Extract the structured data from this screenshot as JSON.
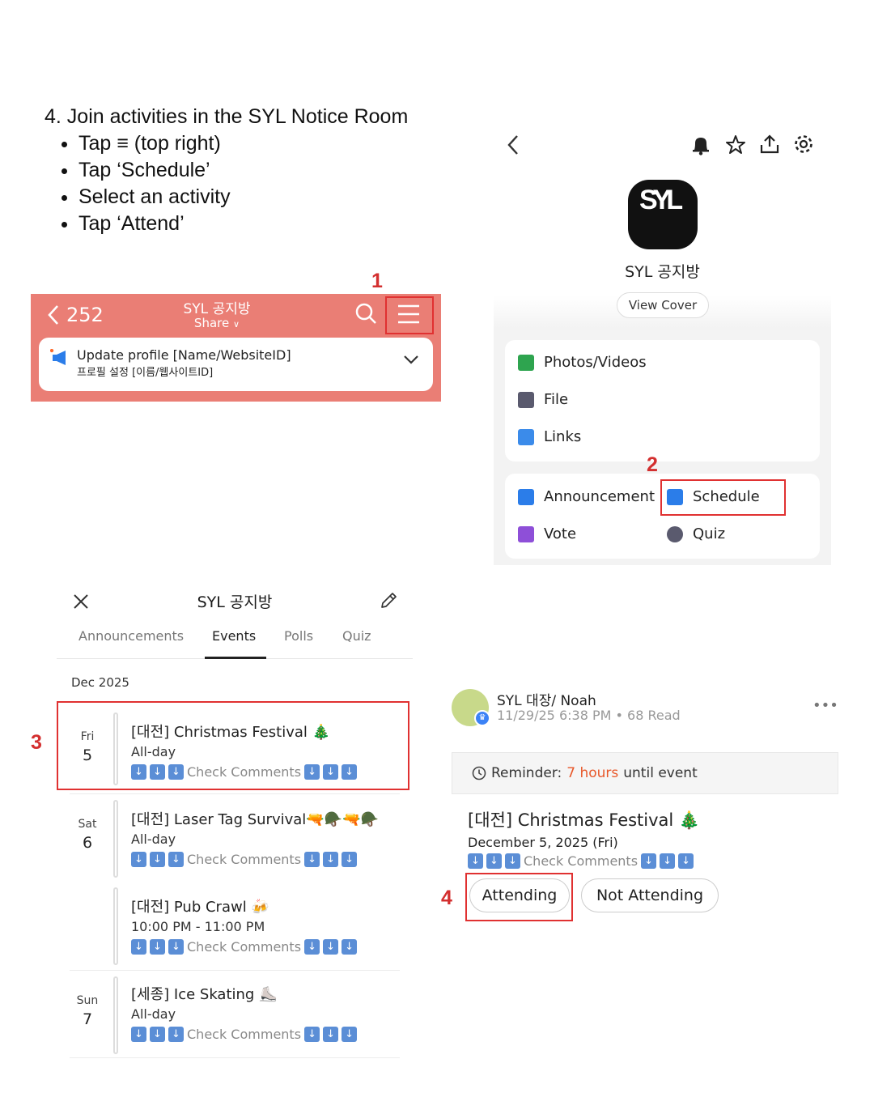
{
  "instructions": {
    "heading": "4. Join activities in the SYL Notice Room",
    "steps": [
      "Tap ≡ (top right)",
      "Tap ‘Schedule’",
      "Select an activity",
      "Tap ‘Attend’"
    ]
  },
  "step_numbers": [
    "1",
    "2",
    "3",
    "4"
  ],
  "chat_header": {
    "count": "252",
    "title": "SYL 공지방",
    "share": "Share",
    "notice_line1": "Update profile [Name/WebsiteID]",
    "notice_line2": "프로필 설정 [이름/웹사이트ID]"
  },
  "room_menu": {
    "logo_text": "SYL",
    "room_name": "SYL 공지방",
    "view_cover": "View Cover",
    "media": [
      "Photos/Videos",
      "File",
      "Links"
    ],
    "tools": [
      "Announcement",
      "Schedule",
      "Vote",
      "Quiz"
    ]
  },
  "events_screen": {
    "title": "SYL 공지방",
    "tabs": [
      "Announcements",
      "Events",
      "Polls",
      "Quiz"
    ],
    "active_tab": "Events",
    "month": "Dec 2025",
    "check_comments": "Check Comments",
    "events": [
      {
        "dow": "Fri",
        "day": "5",
        "title": "[대전] Christmas Festival 🎄",
        "time": "All-day"
      },
      {
        "dow": "Sat",
        "day": "6",
        "title": "[대전] Laser Tag Survival🔫🪖🔫🪖",
        "time": "All-day"
      },
      {
        "dow": "",
        "day": "",
        "title": "[대전] Pub Crawl 🍻",
        "time": "10:00 PM - 11:00 PM"
      },
      {
        "dow": "Sun",
        "day": "7",
        "title": "[세종] Ice Skating ⛸️",
        "time": "All-day"
      }
    ]
  },
  "event_post": {
    "author": "SYL 대장/ Noah",
    "meta": "11/29/25 6:38 PM • 68 Read",
    "more": "•••",
    "reminder_label": "Reminder:",
    "reminder_hours": "7 hours",
    "reminder_suffix": "until event",
    "title": "[대전] Christmas Festival 🎄",
    "date": "December 5, 2025 (Fri)",
    "check_comments": "Check Comments",
    "attending": "Attending",
    "not_attending": "Not Attending"
  },
  "colors": {
    "header_bg": "#ea7e75",
    "highlight": "#e03131",
    "reminder_hours": "#e8582a",
    "arrow_emoji": "#5b8ed6"
  }
}
